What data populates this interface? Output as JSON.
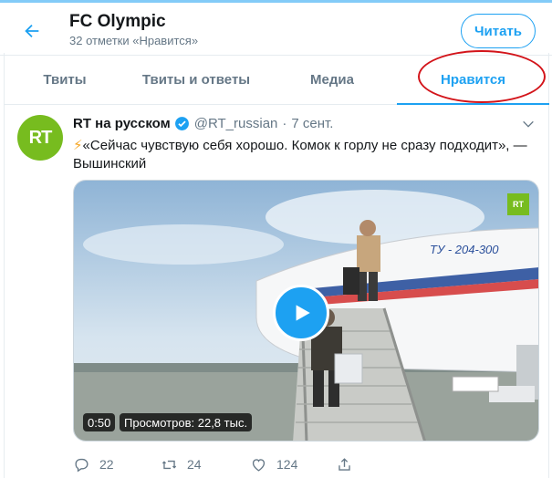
{
  "header": {
    "title": "FC Olympic",
    "subtitle": "32 отметки «Нравится»",
    "follow_label": "Читать"
  },
  "tabs": [
    {
      "label": "Твиты",
      "active": false
    },
    {
      "label": "Твиты и ответы",
      "active": false
    },
    {
      "label": "Медиа",
      "active": false
    },
    {
      "label": "Нравится",
      "active": true
    }
  ],
  "tweet": {
    "author": "RT на русском",
    "avatar_text": "RT",
    "handle": "@RT_russian",
    "separator": "·",
    "date": "7 сент.",
    "emoji": "⚡",
    "text": "«Сейчас чувствую себя хорошо. Комок к горлу не сразу подходит», — Вышинский",
    "media": {
      "logo": "RT",
      "duration": "0:50",
      "views": "Просмотров: 22,8 тыс.",
      "plane_livery": "ТУ - 204-300"
    },
    "actions": {
      "replies": "22",
      "retweets": "24",
      "likes": "124"
    }
  },
  "colors": {
    "accent": "#1da1f2",
    "rt_green": "#77bc1f",
    "highlight_circle": "#d3141a",
    "muted": "#657786"
  },
  "icons": [
    "back-arrow-icon",
    "verified-icon",
    "chevron-down-icon",
    "play-icon",
    "reply-icon",
    "retweet-icon",
    "like-icon",
    "share-icon"
  ]
}
